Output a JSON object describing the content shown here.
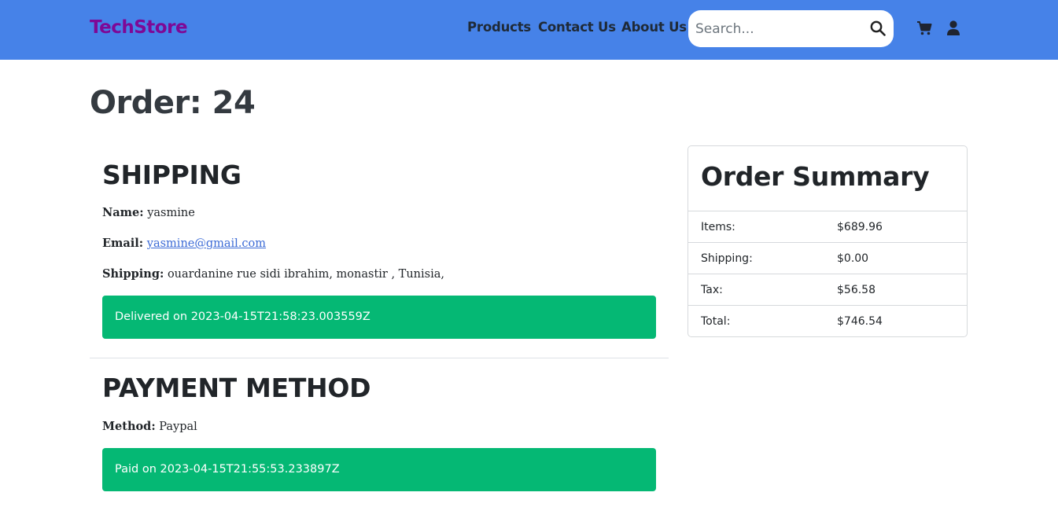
{
  "nav": {
    "brand": "TechStore",
    "links": [
      "Products",
      "Contact Us",
      "About Us"
    ],
    "search_placeholder": "Search...",
    "icons": [
      "search-icon",
      "cart-icon",
      "user-icon"
    ],
    "background_color": "#4682e8",
    "brand_color": "#7e0896"
  },
  "order": {
    "title": "Order: 24"
  },
  "shipping": {
    "heading": "SHIPPING",
    "name_label": "Name:",
    "name_value": "yasmine",
    "email_label": "Email:",
    "email_value": "yasmine@gmail.com",
    "address_label": "Shipping:",
    "address_value": "ouardanine rue sidi ibrahim, monastir , Tunisia,",
    "status": "Delivered on 2023-04-15T21:58:23.003559Z"
  },
  "payment": {
    "heading": "PAYMENT METHOD",
    "method_label": "Method:",
    "method_value": "Paypal",
    "status": "Paid on 2023-04-15T21:55:53.233897Z"
  },
  "summary": {
    "title": "Order Summary",
    "rows": [
      {
        "label": "Items:",
        "value": "$689.96"
      },
      {
        "label": "Shipping:",
        "value": "$0.00"
      },
      {
        "label": "Tax:",
        "value": "$56.58"
      },
      {
        "label": "Total:",
        "value": "$746.54"
      }
    ]
  },
  "colors": {
    "success": "#05b874",
    "link": "#3c6bd6"
  }
}
